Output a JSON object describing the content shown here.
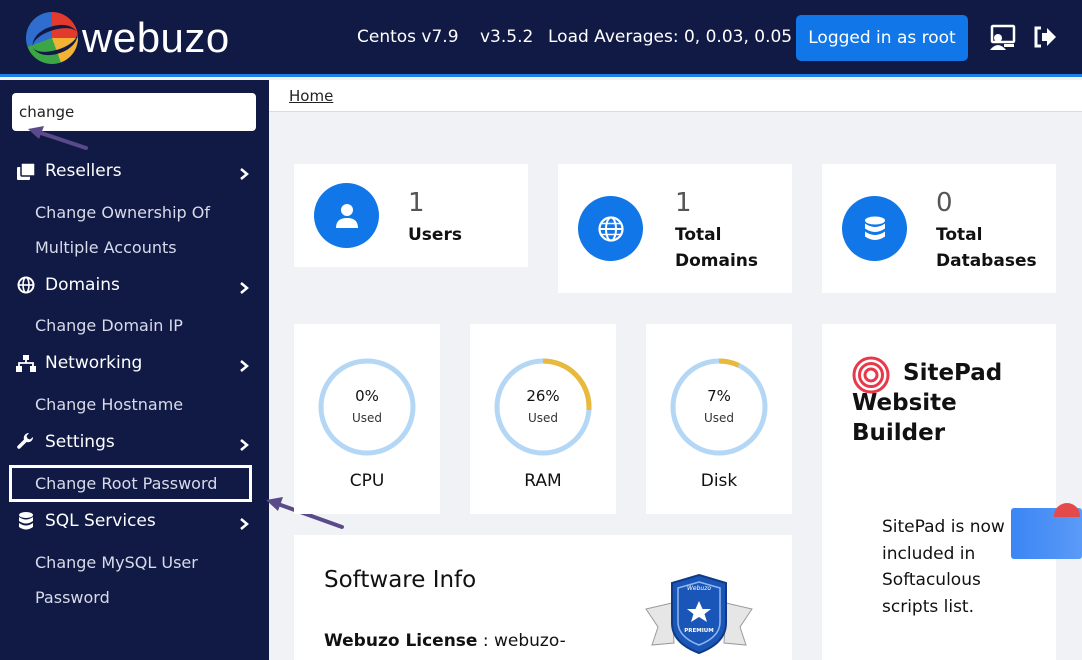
{
  "header": {
    "logo_text": "webuzo",
    "os": "Centos v7.9",
    "version": "v3.5.2",
    "load_averages": "Load Averages: 0, 0.03, 0.05",
    "login_button": "Logged in as root",
    "icons": [
      "user-switch-icon",
      "logout-icon"
    ]
  },
  "sidebar": {
    "search_value": "change",
    "groups": [
      {
        "label": "Resellers",
        "icon": "resellers-icon",
        "items": [
          "Change Ownership Of",
          "Multiple Accounts"
        ]
      },
      {
        "label": "Domains",
        "icon": "globe-icon",
        "items": [
          "Change Domain IP"
        ]
      },
      {
        "label": "Networking",
        "icon": "network-icon",
        "items": [
          "Change Hostname"
        ]
      },
      {
        "label": "Settings",
        "icon": "wrench-icon",
        "items": [
          "Change Root Password"
        ]
      },
      {
        "label": "SQL Services",
        "icon": "database-icon",
        "items": [
          "Change MySQL User",
          "Password"
        ]
      }
    ]
  },
  "breadcrumb": "Home",
  "stats": [
    {
      "value": "1",
      "label_line1": "Users",
      "label_line2": "",
      "icon": "user-icon"
    },
    {
      "value": "1",
      "label_line1": "Total",
      "label_line2": "Domains",
      "icon": "globe-icon"
    },
    {
      "value": "0",
      "label_line1": "Total",
      "label_line2": "Databases",
      "icon": "database-icon"
    }
  ],
  "gauges": [
    {
      "name": "CPU",
      "percent_text": "0%",
      "used": "Used",
      "fraction": 0.0
    },
    {
      "name": "RAM",
      "percent_text": "26%",
      "used": "Used",
      "fraction": 0.26
    },
    {
      "name": "Disk",
      "percent_text": "7%",
      "used": "Used",
      "fraction": 0.07
    }
  ],
  "colors": {
    "track": "#b3d7f5",
    "fill": "#e8b93a",
    "accent": "#1177e8",
    "sidebar": "#111a45"
  },
  "sitepad": {
    "title_line1": "SitePad",
    "title_line2": "Website",
    "title_line3": "Builder",
    "text": "SitePad is now included in Softaculous scripts list."
  },
  "software_info": {
    "title": "Software Info",
    "license_label": "Webuzo License",
    "license_value": ": webuzo-",
    "badge_top": "Webuzo",
    "badge_bottom": "PREMIUM"
  }
}
